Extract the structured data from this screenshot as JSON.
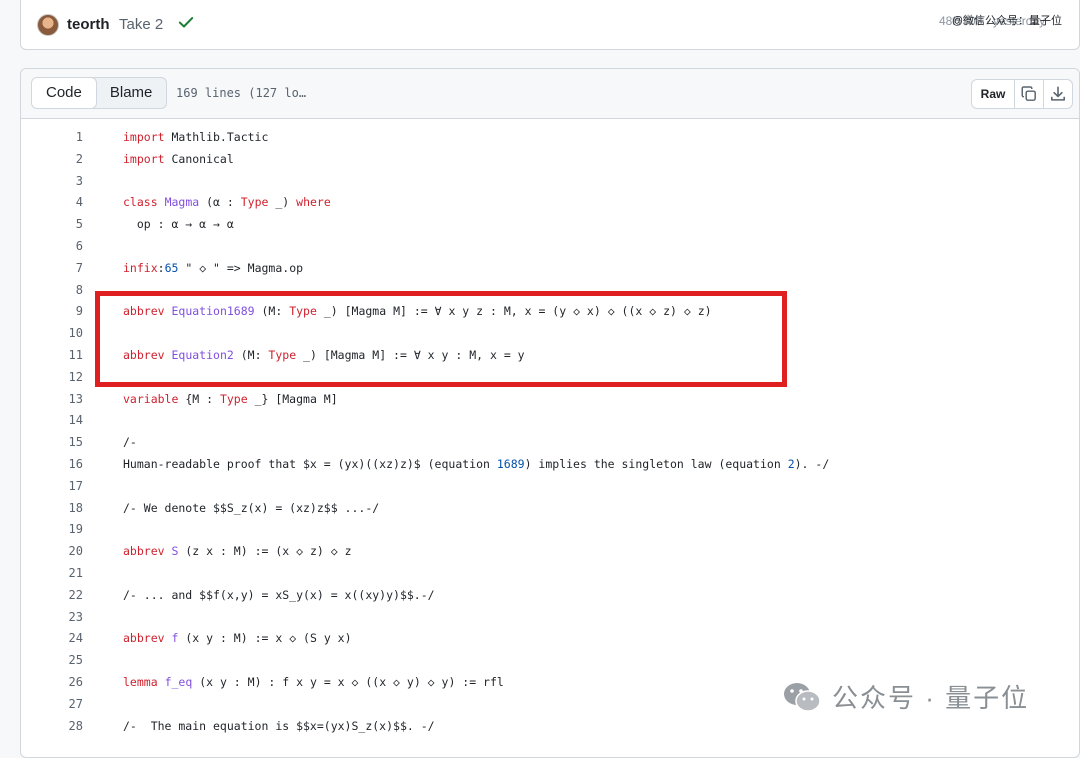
{
  "commit": {
    "author": "teorth",
    "message": "Take 2",
    "meta": "48f5308 · yesterday"
  },
  "watermark_top": "@微信公众号：量子位",
  "watermark_bottom": "公众号 · 量子位",
  "file_header": {
    "tabs": [
      "Code",
      "Blame"
    ],
    "active_tab": "Code",
    "line_info": "169 lines (127 lo…",
    "raw_label": "Raw",
    "icons": [
      "copy-icon",
      "download-icon"
    ]
  },
  "code_lines": [
    {
      "n": "1",
      "t": "import Mathlib.Tactic"
    },
    {
      "n": "2",
      "t": "import Canonical"
    },
    {
      "n": "3",
      "t": ""
    },
    {
      "n": "4",
      "t": "class Magma (α : Type _) where"
    },
    {
      "n": "5",
      "t": "  op : α → α → α"
    },
    {
      "n": "6",
      "t": ""
    },
    {
      "n": "7",
      "t": "infix:65 \" ◇ \" => Magma.op"
    },
    {
      "n": "8",
      "t": ""
    },
    {
      "n": "9",
      "t": "abbrev Equation1689 (M: Type _) [Magma M] := ∀ x y z : M, x = (y ◇ x) ◇ ((x ◇ z) ◇ z)"
    },
    {
      "n": "10",
      "t": ""
    },
    {
      "n": "11",
      "t": "abbrev Equation2 (M: Type _) [Magma M] := ∀ x y : M, x = y"
    },
    {
      "n": "12",
      "t": ""
    },
    {
      "n": "13",
      "t": "variable {M : Type _} [Magma M]"
    },
    {
      "n": "14",
      "t": ""
    },
    {
      "n": "15",
      "t": "/-"
    },
    {
      "n": "16",
      "t": "Human-readable proof that $x = (yx)((xz)z)$ (equation 1689) implies the singleton law (equation 2). -/"
    },
    {
      "n": "17",
      "t": ""
    },
    {
      "n": "18",
      "t": "/- We denote $$S_z(x) = (xz)z$$ ...-/"
    },
    {
      "n": "19",
      "t": ""
    },
    {
      "n": "20",
      "t": "abbrev S (z x : M) := (x ◇ z) ◇ z"
    },
    {
      "n": "21",
      "t": ""
    },
    {
      "n": "22",
      "t": "/- ... and $$f(x,y) = xS_y(x) = x((xy)y)$$.-/"
    },
    {
      "n": "23",
      "t": ""
    },
    {
      "n": "24",
      "t": "abbrev f (x y : M) := x ◇ (S y x)"
    },
    {
      "n": "25",
      "t": ""
    },
    {
      "n": "26",
      "t": "lemma f_eq (x y : M) : f x y = x ◇ ((x ◇ y) ◇ y) := rfl"
    },
    {
      "n": "27",
      "t": ""
    },
    {
      "n": "28",
      "t": "/-  The main equation is $$x=(yx)S_z(x)$$. -/"
    }
  ],
  "colors": {
    "keyword": "#cf222e",
    "name": "#8250df",
    "number": "#0550ae",
    "highlight_box": "#e02020",
    "check": "#1a7f37"
  }
}
